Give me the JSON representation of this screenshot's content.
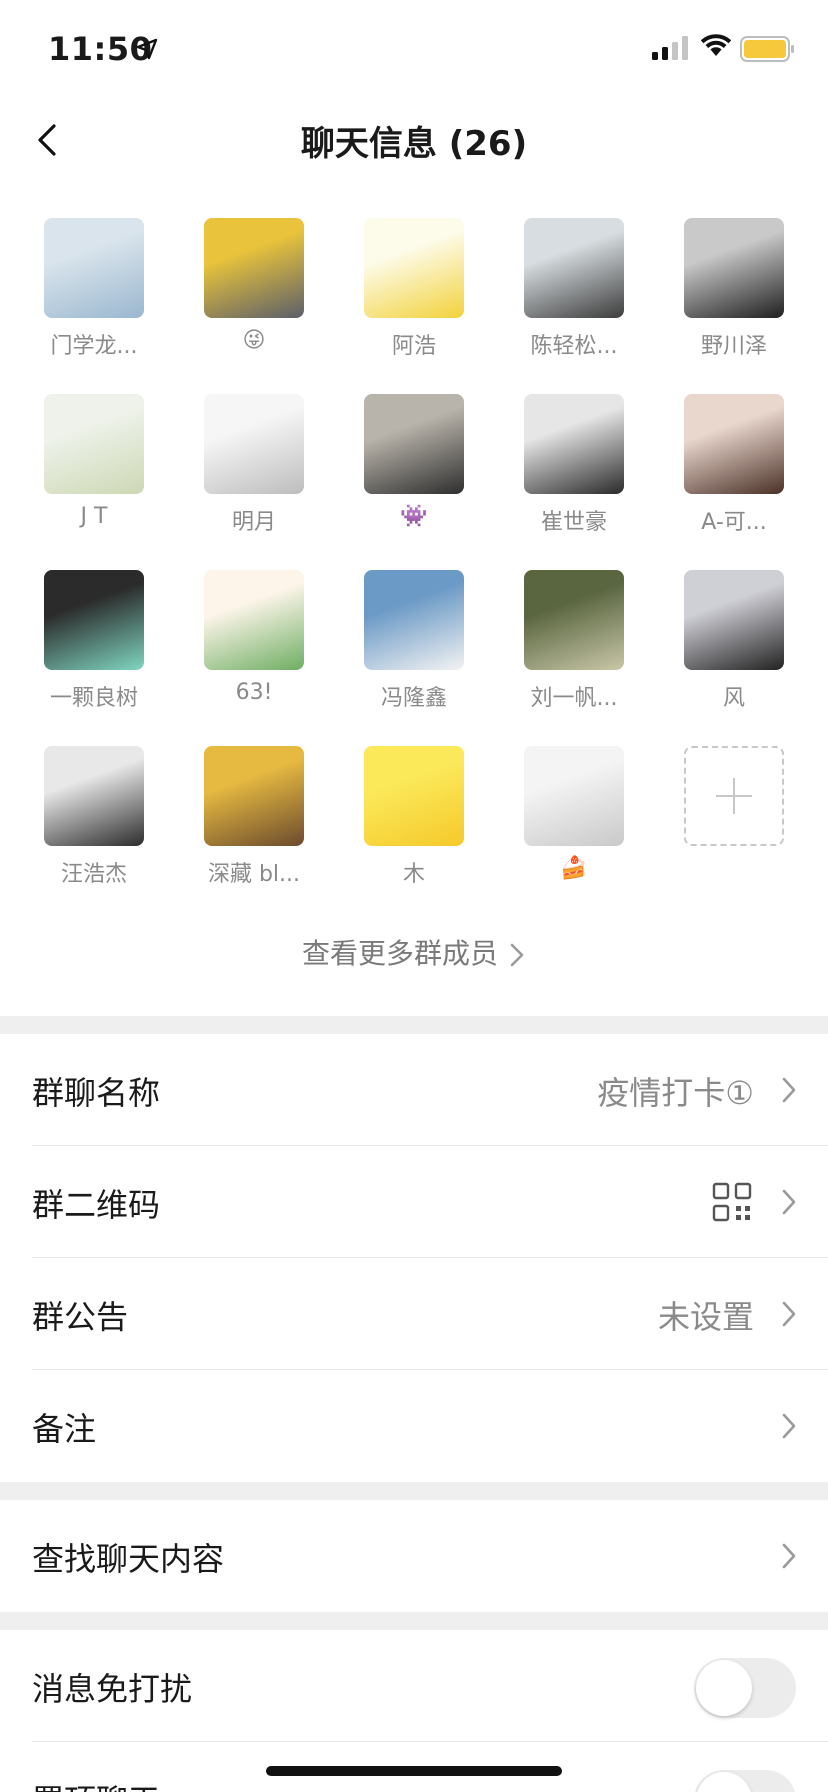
{
  "status_bar": {
    "time": "11:50"
  },
  "nav": {
    "title": "聊天信息 (26)"
  },
  "members": [
    {
      "name": "门学龙...",
      "avatar_colors": [
        "#d9e4ec",
        "#9ab7cf"
      ]
    },
    {
      "name": "😜",
      "avatar_colors": [
        "#e8c33b",
        "#5b5e6a"
      ]
    },
    {
      "name": "阿浩",
      "avatar_colors": [
        "#fdfbe9",
        "#f2d23b"
      ]
    },
    {
      "name": "陈轻松...",
      "avatar_colors": [
        "#d7dde0",
        "#3c3c3c"
      ]
    },
    {
      "name": "野川泽",
      "avatar_colors": [
        "#c9c9c9",
        "#1f1f1f"
      ]
    },
    {
      "name": "J T",
      "avatar_colors": [
        "#eef2ea",
        "#cdd8b4"
      ]
    },
    {
      "name": "明月",
      "avatar_colors": [
        "#f6f6f6",
        "#bdbdbd"
      ]
    },
    {
      "name": "👾",
      "avatar_colors": [
        "#b9b4ab",
        "#2e2e2e"
      ]
    },
    {
      "name": "崔世豪",
      "avatar_colors": [
        "#e6e6e6",
        "#2a2a2a"
      ]
    },
    {
      "name": "A-可...",
      "avatar_colors": [
        "#e9d6cc",
        "#4a3128"
      ]
    },
    {
      "name": "一颗良树",
      "avatar_colors": [
        "#2b2b2b",
        "#7fd6c1"
      ]
    },
    {
      "name": "63!",
      "avatar_colors": [
        "#fdf5ea",
        "#6fae63"
      ]
    },
    {
      "name": "冯隆鑫",
      "avatar_colors": [
        "#6c9ac6",
        "#f3f3f3"
      ]
    },
    {
      "name": "刘一帆...",
      "avatar_colors": [
        "#5a6640",
        "#c9c7a8"
      ]
    },
    {
      "name": "风",
      "avatar_colors": [
        "#cfcfd6",
        "#222"
      ]
    },
    {
      "name": "汪浩杰",
      "avatar_colors": [
        "#e8e8e8",
        "#2c2c2c"
      ]
    },
    {
      "name": "深藏 bl...",
      "avatar_colors": [
        "#e6b941",
        "#6b4b2d"
      ]
    },
    {
      "name": "木",
      "avatar_colors": [
        "#fbe95a",
        "#f5c92b"
      ]
    },
    {
      "name": "🍰",
      "avatar_colors": [
        "#f4f4f4",
        "#c9c9c9"
      ]
    }
  ],
  "more_members_label": "查看更多群成员",
  "settings": {
    "group_name_label": "群聊名称",
    "group_name_value": "疫情打卡①",
    "qr_label": "群二维码",
    "notice_label": "群公告",
    "notice_value": "未设置",
    "remark_label": "备注",
    "search_label": "查找聊天内容",
    "mute_label": "消息免打扰",
    "mute_on": false,
    "pin_label": "置顶聊天",
    "pin_on": false
  },
  "colors": {
    "battery": "#f5c93b",
    "separator": "#efefef"
  }
}
